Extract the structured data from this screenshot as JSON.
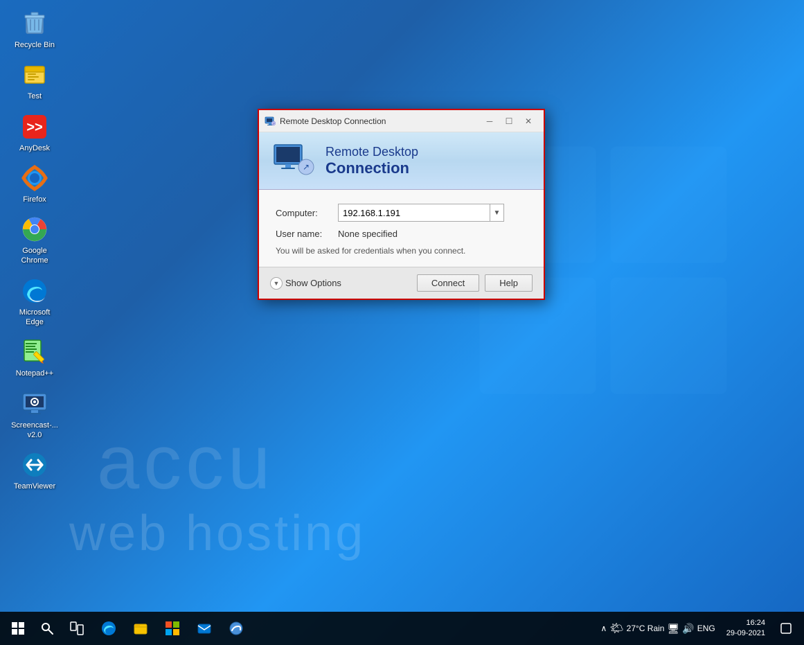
{
  "desktop": {
    "background_color": "#1565c0"
  },
  "icons": [
    {
      "id": "recycle-bin",
      "label": "Recycle Bin",
      "type": "recycle-bin"
    },
    {
      "id": "test",
      "label": "Test",
      "type": "folder"
    },
    {
      "id": "anydesk",
      "label": "AnyDesk",
      "type": "anydesk"
    },
    {
      "id": "firefox",
      "label": "Firefox",
      "type": "firefox"
    },
    {
      "id": "chrome",
      "label": "Google Chrome",
      "type": "chrome"
    },
    {
      "id": "edge",
      "label": "Microsoft Edge",
      "type": "edge"
    },
    {
      "id": "notepadpp",
      "label": "Notepad++",
      "type": "notepadpp"
    },
    {
      "id": "screencast",
      "label": "Screencast-...\nv2.0",
      "type": "screencast"
    },
    {
      "id": "teamviewer",
      "label": "TeamViewer",
      "type": "teamviewer"
    }
  ],
  "rdp_dialog": {
    "titlebar": {
      "title": "Remote Desktop Connection",
      "minimize": "─",
      "maximize": "☐",
      "close": "✕"
    },
    "header": {
      "line1": "Remote Desktop",
      "line2": "Connection"
    },
    "fields": {
      "computer_label": "Computer:",
      "computer_value": "192.168.1.191",
      "username_label": "User name:",
      "username_value": "None specified",
      "credentials_note": "You will be asked for credentials when you connect."
    },
    "footer": {
      "show_options": "Show Options",
      "connect_btn": "Connect",
      "help_btn": "Help"
    }
  },
  "taskbar": {
    "weather": "27°C  Rain",
    "time": "16:24",
    "date": "29-09-2021",
    "language": "ENG"
  }
}
